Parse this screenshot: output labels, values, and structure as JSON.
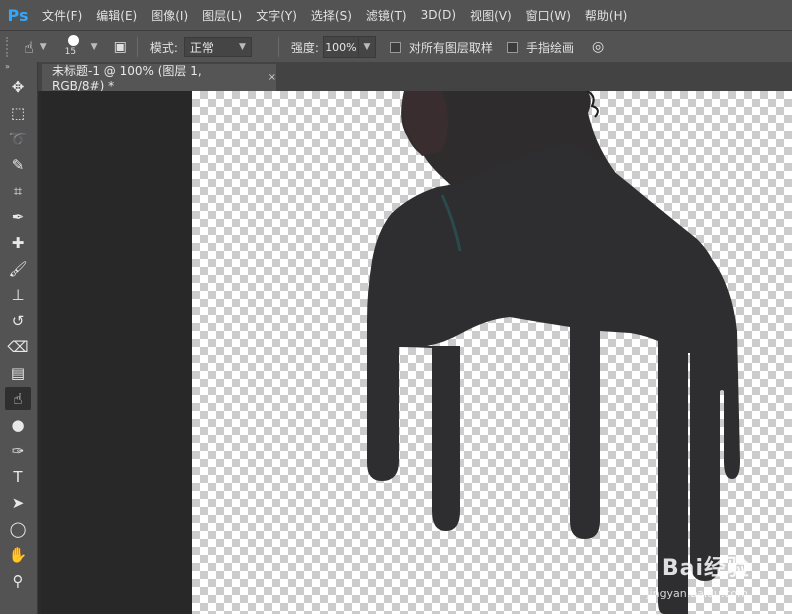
{
  "app": {
    "logo": "Ps"
  },
  "menu": [
    "文件(F)",
    "编辑(E)",
    "图像(I)",
    "图层(L)",
    "文字(Y)",
    "选择(S)",
    "滤镜(T)",
    "3D(D)",
    "视图(V)",
    "窗口(W)",
    "帮助(H)"
  ],
  "options": {
    "tool_icon": "smudge-icon",
    "brush_size": "15",
    "mode_label": "模式:",
    "mode_value": "正常",
    "strength_label": "强度:",
    "strength_value": "100%",
    "sample_all_layers_label": "对所有图层取样",
    "finger_painting_label": "手指绘画"
  },
  "toolbar": {
    "collapse_glyph": "»",
    "tools": [
      {
        "name": "move-tool-icon",
        "glyph": "✥",
        "active": false
      },
      {
        "name": "marquee-tool-icon",
        "glyph": "⬚",
        "active": false
      },
      {
        "name": "lasso-tool-icon",
        "glyph": "➰",
        "active": false
      },
      {
        "name": "quick-selection-tool-icon",
        "glyph": "✎",
        "active": false
      },
      {
        "name": "crop-tool-icon",
        "glyph": "⌗",
        "active": false
      },
      {
        "name": "eyedropper-tool-icon",
        "glyph": "✒",
        "active": false
      },
      {
        "name": "healing-brush-tool-icon",
        "glyph": "✚",
        "active": false
      },
      {
        "name": "brush-tool-icon",
        "glyph": "🖌",
        "active": false
      },
      {
        "name": "clone-stamp-tool-icon",
        "glyph": "⊥",
        "active": false
      },
      {
        "name": "history-brush-tool-icon",
        "glyph": "↺",
        "active": false
      },
      {
        "name": "eraser-tool-icon",
        "glyph": "⌫",
        "active": false
      },
      {
        "name": "gradient-tool-icon",
        "glyph": "▤",
        "active": false
      },
      {
        "name": "smudge-tool-icon",
        "glyph": "☝",
        "active": true
      },
      {
        "name": "dodge-tool-icon",
        "glyph": "●",
        "active": false
      },
      {
        "name": "pen-tool-icon",
        "glyph": "✑",
        "active": false
      },
      {
        "name": "type-tool-icon",
        "glyph": "T",
        "active": false
      },
      {
        "name": "path-selection-tool-icon",
        "glyph": "➤",
        "active": false
      },
      {
        "name": "ellipse-tool-icon",
        "glyph": "◯",
        "active": false
      },
      {
        "name": "hand-tool-icon",
        "glyph": "✋",
        "active": false
      },
      {
        "name": "zoom-tool-icon",
        "glyph": "⚲",
        "active": false
      }
    ]
  },
  "document": {
    "tab_title": "未标题-1 @ 100% (图层 1, RGB/8#) *",
    "close_glyph": "×"
  },
  "watermark": {
    "brand": "Bai经验",
    "url": "jingyan.baidu.com"
  },
  "colors": {
    "figure": "#2e2d2f",
    "panel": "#535353",
    "workspace": "#282828",
    "accent": "#31a8ff"
  }
}
